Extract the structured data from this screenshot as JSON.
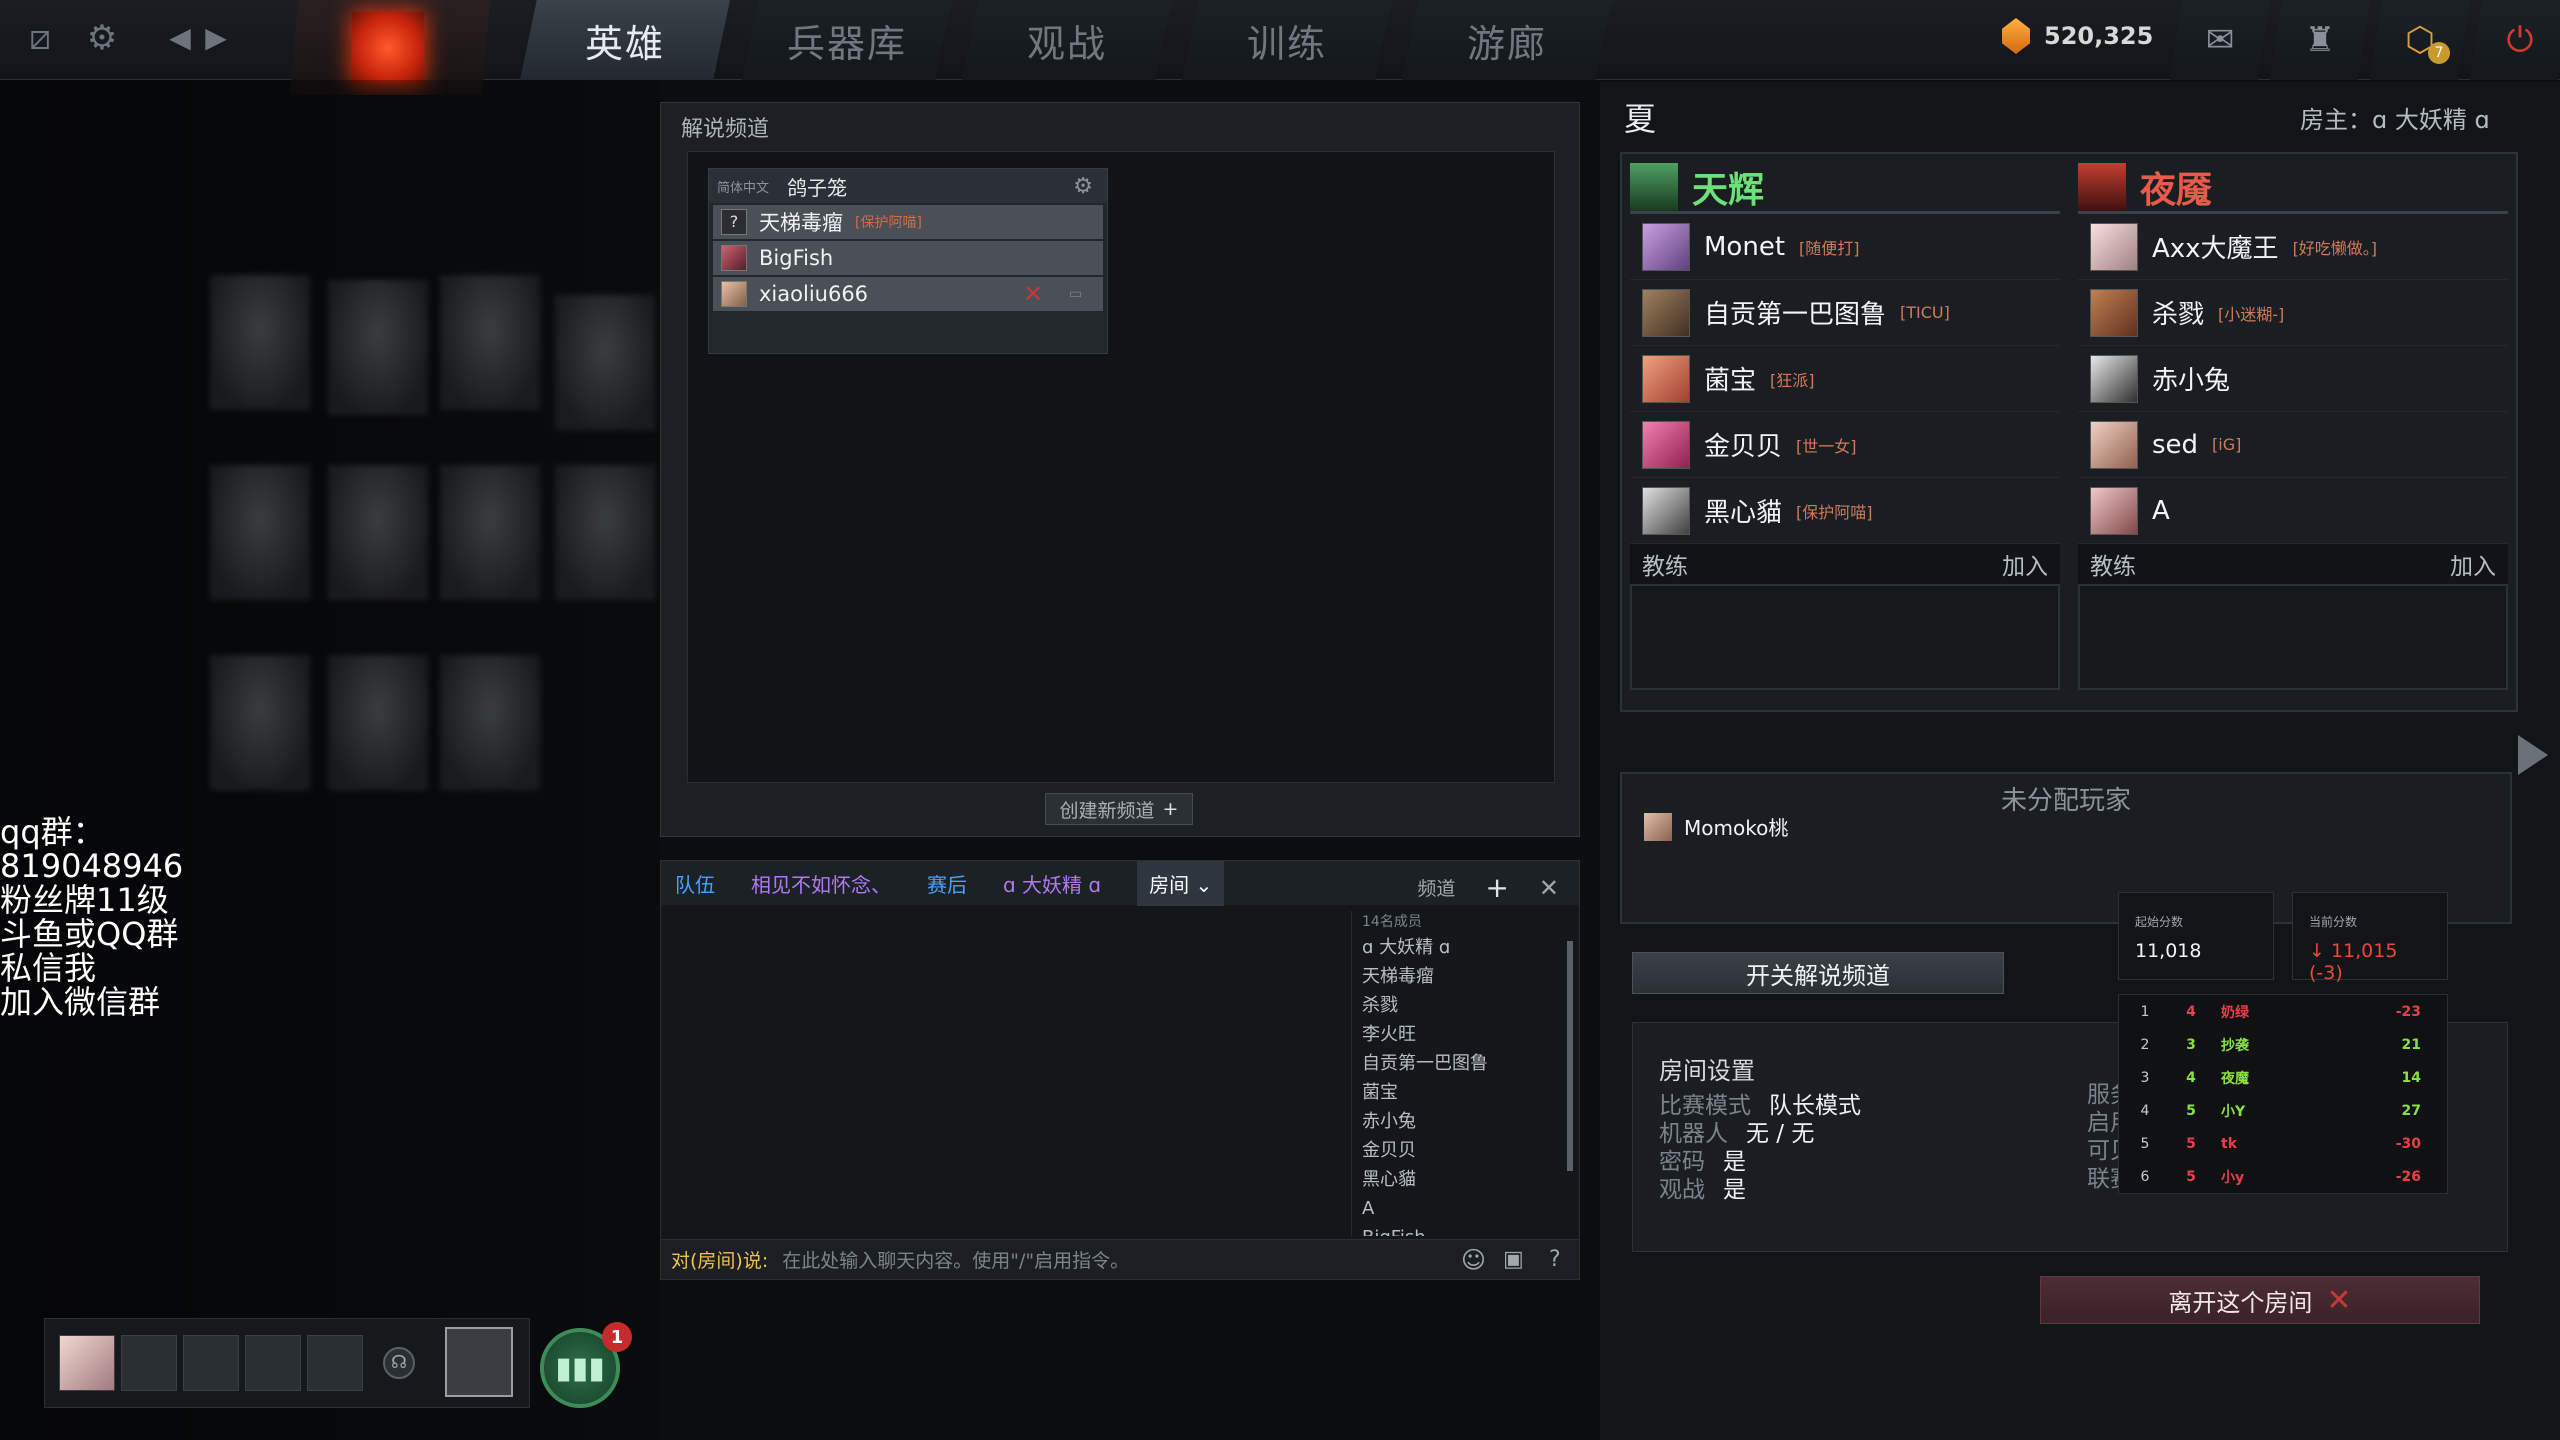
{
  "top_nav": {
    "tabs": [
      "英雄",
      "兵器库",
      "观战",
      "训练",
      "游廊"
    ],
    "active_tab": "英雄",
    "currency_amount": "520,325",
    "notification_count": "7"
  },
  "stream_overlay": {
    "lines": [
      "qq群：",
      "819048946",
      "粉丝牌11级",
      "斗鱼或QQ群",
      "私信我",
      "加入微信群"
    ]
  },
  "party": {
    "invite_count": "1"
  },
  "commentary": {
    "title": "解说频道",
    "channel_language": "简体中文",
    "channel_name": "鸽子笼",
    "members": [
      {
        "name": "天梯毒瘤",
        "tag": "[保护阿喵]"
      },
      {
        "name": "BigFish",
        "tag": ""
      },
      {
        "name": "xiaoliu666",
        "tag": ""
      }
    ],
    "create_channel_label": "创建新频道"
  },
  "chat": {
    "tabs": [
      "队伍",
      "相见不如怀念、",
      "赛后",
      "ɑ 大妖精 ɑ",
      "房间"
    ],
    "channels_label": "频道",
    "member_count_label": "14名成员",
    "members": [
      "ɑ 大妖精 ɑ",
      "天梯毒瘤",
      "杀戮",
      "李火旺",
      "自贡第一巴图鲁",
      "菌宝",
      "赤小兔",
      "金贝贝",
      "黑心貓",
      "A",
      "BigFish"
    ],
    "input_label": "对(房间)说:",
    "input_placeholder": "在此处输入聊天内容。使用\"/\"启用指令。"
  },
  "lobby": {
    "title": "夏",
    "host_label": "房主：ɑ 大妖精 ɑ",
    "radiant": {
      "name": "天辉",
      "color": "#6ee07a",
      "players": [
        {
          "name": "Monet",
          "tag": "[随便打]"
        },
        {
          "name": "自贡第一巴图鲁",
          "tag": "[TICU]"
        },
        {
          "name": "菌宝",
          "tag": "[狂派]"
        },
        {
          "name": "金贝贝",
          "tag": "[世一女]"
        },
        {
          "name": "黑心貓",
          "tag": "[保护阿喵]"
        }
      ]
    },
    "dire": {
      "name": "夜魇",
      "color": "#e85a4a",
      "players": [
        {
          "name": "Axx大魔王",
          "tag": "[好吃懒做。]"
        },
        {
          "name": "杀戮",
          "tag": "[小迷糊-]"
        },
        {
          "name": "赤小兔",
          "tag": ""
        },
        {
          "name": "sed",
          "tag": "[iG]"
        },
        {
          "name": "A",
          "tag": ""
        }
      ]
    },
    "coach_label": "教练",
    "join_label": "加入",
    "unassigned_title": "未分配玩家",
    "unassigned_player": "Momoko桃",
    "toggle_commentary_label": "开关解说频道",
    "settings": {
      "title": "房间设置",
      "rows": [
        {
          "k": "比赛模式",
          "v": "队长模式"
        },
        {
          "k": "机器人",
          "v": "无 / 无"
        },
        {
          "k": "密码",
          "v": "是"
        },
        {
          "k": "观战",
          "v": "是"
        }
      ],
      "right_labels": [
        "服务",
        "启用",
        "可见",
        "联赛"
      ]
    },
    "leave_label": "离开这个房间"
  },
  "score_overlay": {
    "start_label": "起始分数",
    "start_value": "11,018",
    "current_label": "当前分数",
    "current_value": "↓ 11,015 (-3)",
    "rows": [
      {
        "rank": "1",
        "n": "4",
        "name": "奶绿",
        "delta": "-23",
        "color": "#e8404a"
      },
      {
        "rank": "2",
        "n": "3",
        "name": "抄袭",
        "delta": "21",
        "color": "#8ae040"
      },
      {
        "rank": "3",
        "n": "4",
        "name": "夜魔",
        "delta": "14",
        "color": "#8ae040"
      },
      {
        "rank": "4",
        "n": "5",
        "name": "小Y",
        "delta": "27",
        "color": "#8ae040"
      },
      {
        "rank": "5",
        "n": "5",
        "name": "tk",
        "delta": "-30",
        "color": "#e8404a"
      },
      {
        "rank": "6",
        "n": "5",
        "name": "小y",
        "delta": "-26",
        "color": "#e8404a"
      }
    ]
  }
}
